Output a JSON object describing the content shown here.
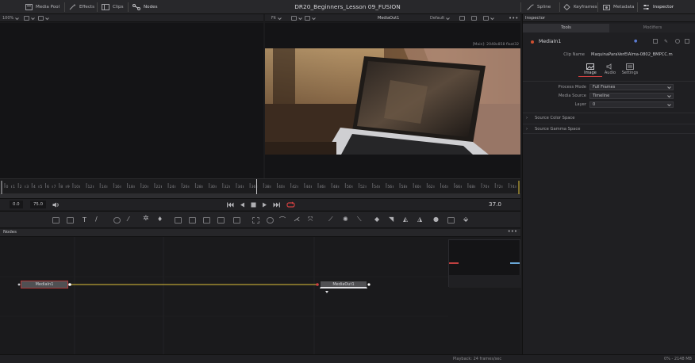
{
  "topbar": {
    "media_pool": "Media Pool",
    "effects": "Effects",
    "clips": "Clips",
    "nodes": "Nodes",
    "title": "DR20_Beginners_Lesson 09_FUSION",
    "spline": "Spline",
    "keyframes": "Keyframes",
    "metadata": "Metadata",
    "inspector": "Inspector"
  },
  "viewer_left": {
    "zoom": "100%"
  },
  "viewer_right": {
    "zoom": "Fit",
    "name": "MediaOut1",
    "lut": "Default",
    "resolution": "[Main]: 2048x858 float32"
  },
  "inspector": {
    "header": "Inspector",
    "tabs": [
      "Tools",
      "Modifiers"
    ],
    "node_name": "MediaIn1",
    "clip_name_label": "Clip Name",
    "clip_name_value": "MaquinaParaVerElAlma-0802_BMPCC.m",
    "sub_tabs": [
      "Image",
      "Audio",
      "Settings"
    ],
    "process_mode_label": "Process Mode",
    "process_mode_value": "Full Frames",
    "media_source_label": "Media Source",
    "media_source_value": "Timeline",
    "layer_label": "Layer",
    "layer_value": "0",
    "sections": [
      "Source Color Space",
      "Source Gamma Space"
    ]
  },
  "timeline": {
    "ticks": [
      "0",
      "1",
      "2",
      "3",
      "4",
      "5",
      "6",
      "7",
      "8",
      "9",
      "10",
      "12",
      "14",
      "16",
      "18",
      "20",
      "22",
      "24",
      "26",
      "28",
      "30",
      "32",
      "34",
      "36",
      "38",
      "40",
      "42",
      "44",
      "46",
      "48",
      "50",
      "52",
      "54",
      "56",
      "58",
      "60",
      "62",
      "64",
      "66",
      "68",
      "70",
      "72",
      "74"
    ],
    "in_point": "0.0",
    "out_point": "75.0",
    "current_frame": "37.0",
    "playhead_frac": 0.493
  },
  "nodes_panel": {
    "title": "Nodes",
    "media_in": "MediaIn1",
    "media_out": "MediaOut1"
  },
  "status": {
    "playback": "Playback: 24 frames/sec",
    "memory": "0% - 2148 MB"
  },
  "colors": {
    "connection": "#e0c23a",
    "playhead": "#c8c8cc",
    "loop": "#d04040"
  }
}
